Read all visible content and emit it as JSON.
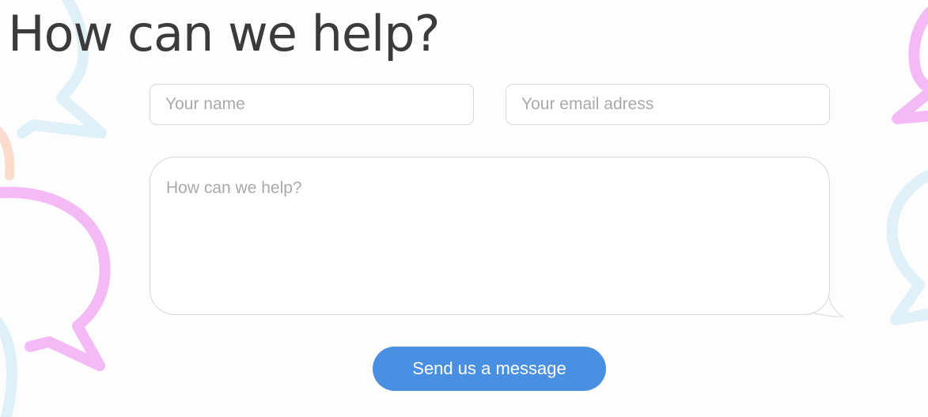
{
  "contact": {
    "heading": "How can we help?",
    "name_placeholder": "Your name",
    "email_placeholder": "Your email adress",
    "message_placeholder": "How can we help?",
    "send_label": "Send us a message"
  },
  "colors": {
    "accent": "#4a90e2",
    "deco_blue": "#d9eef8",
    "deco_pink": "#f2b8f5",
    "deco_peach": "#fbd7c8"
  },
  "icons": [
    "speech-bubble-icon"
  ]
}
